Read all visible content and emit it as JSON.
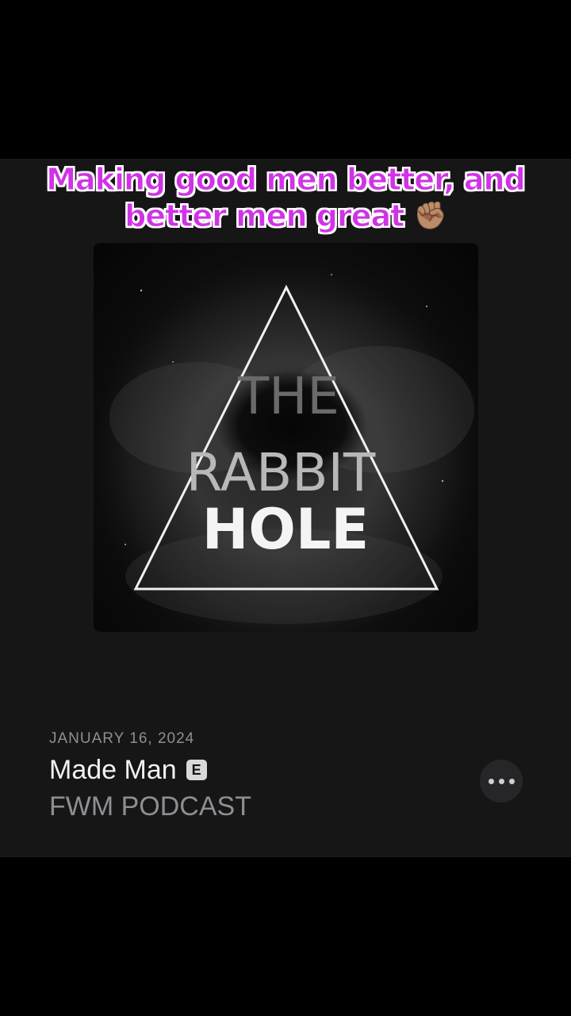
{
  "caption": {
    "text": "Making good men better, and better men great",
    "emoji": "✊🏽"
  },
  "artwork": {
    "line1": "THE",
    "line2": "RABBIT",
    "line3": "HOLE",
    "icon": "triangle-logo"
  },
  "episode": {
    "date": "JANUARY 16, 2024",
    "title": "Made Man",
    "explicit_badge": "E",
    "podcast_name": "FWM PODCAST"
  },
  "more_button": {
    "icon": "ellipsis-icon"
  },
  "colors": {
    "caption_fill": "#d033e6",
    "caption_outline": "#ffffff",
    "panel_bg": "#161617",
    "secondary_text": "#8e8e93"
  }
}
